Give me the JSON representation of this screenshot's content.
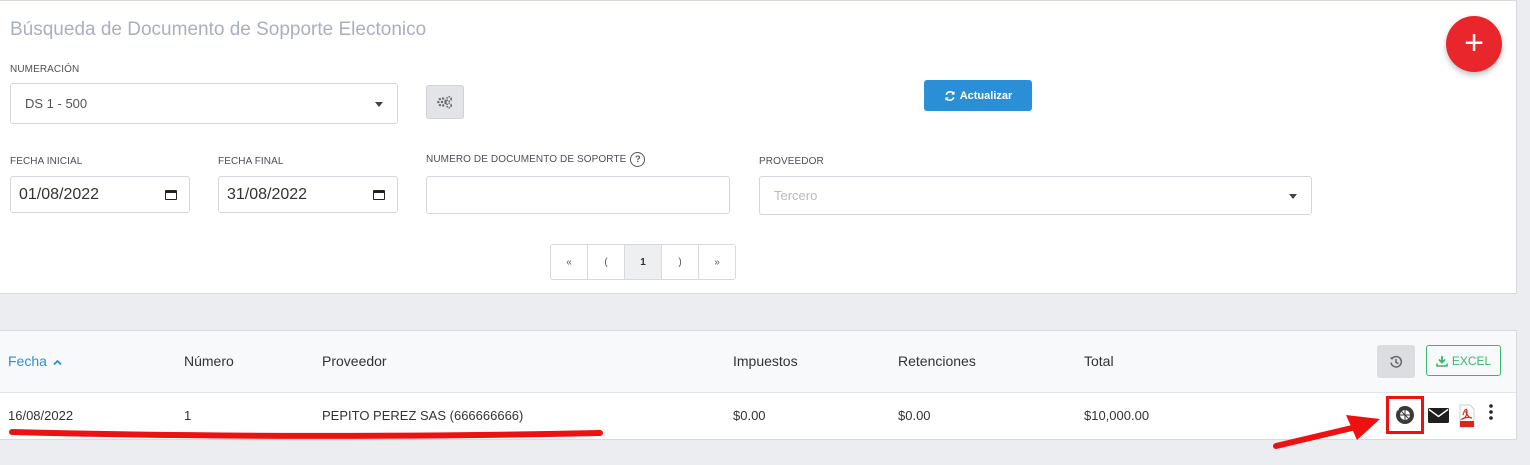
{
  "page": {
    "title": "Búsqueda de Documento de Sopporte Electonico"
  },
  "filters": {
    "numeracion_label": "NUMERACIÓN",
    "numeracion_value": "DS 1 - 500",
    "fecha_inicial_label": "FECHA INICIAL",
    "fecha_inicial_value": "01/08/2022",
    "fecha_final_label": "FECHA FINAL",
    "fecha_final_value": "31/08/2022",
    "numero_doc_label": "NUMERO DE DOCUMENTO DE SOPORTE",
    "numero_doc_value": "",
    "proveedor_label": "PROVEEDOR",
    "proveedor_placeholder": "Tercero"
  },
  "toolbar": {
    "update_label": "Actualizar",
    "help_glyph": "?",
    "fab_glyph": "+"
  },
  "pagination": [
    "«",
    "(",
    "1",
    ")",
    "»"
  ],
  "table": {
    "columns": [
      "Fecha",
      "Número",
      "Proveedor",
      "Impuestos",
      "Retenciones",
      "Total"
    ],
    "sort_column": "Fecha",
    "excel_label": "EXCEL",
    "rows": [
      {
        "fecha": "16/08/2022",
        "numero": "1",
        "proveedor": "PEPITO PEREZ SAS (666666666)",
        "impuestos": "$0.00",
        "retenciones": "$0.00",
        "total": "$10,000.00"
      }
    ]
  },
  "icons": {
    "gear": "cogs-icon",
    "refresh": "refresh-icon",
    "history": "history-icon",
    "download": "download-icon",
    "dian": "dian-icon",
    "email": "envelope-icon",
    "pdf": "pdf-icon",
    "more": "more-vertical-icon"
  },
  "colors": {
    "accent": "#2b8fd8",
    "fab": "#e8262b",
    "excel": "#3ab56b",
    "annotation": "#ee1111"
  }
}
